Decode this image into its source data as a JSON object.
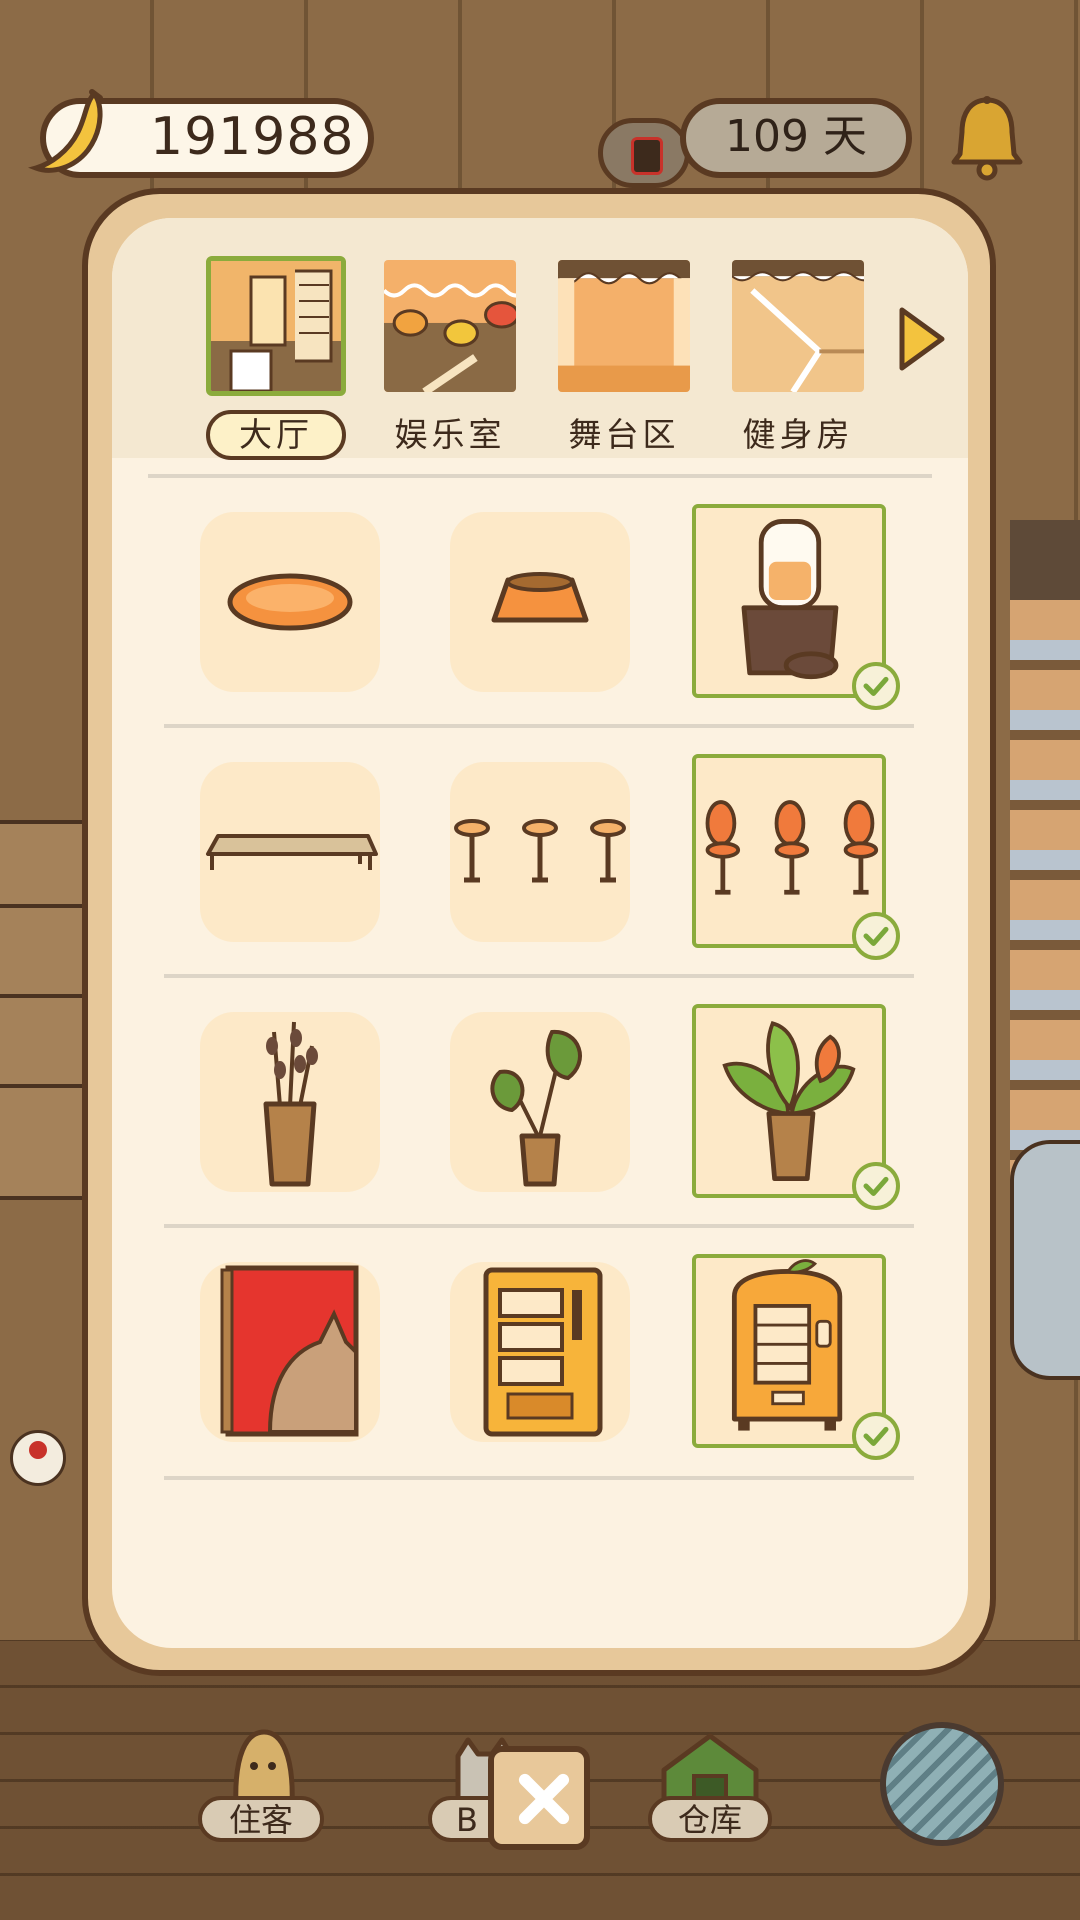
{
  "hud": {
    "coins": "191988",
    "days": "109 天"
  },
  "tabs": [
    {
      "label": "大厅",
      "active": true
    },
    {
      "label": "娱乐室",
      "active": false
    },
    {
      "label": "舞台区",
      "active": false
    },
    {
      "label": "健身房",
      "active": false
    }
  ],
  "items": [
    {
      "icon": "cat-bed-icon",
      "selected": false
    },
    {
      "icon": "food-bowl-icon",
      "selected": false
    },
    {
      "icon": "food-dispenser-icon",
      "selected": true
    },
    {
      "icon": "wooden-bench-icon",
      "selected": false
    },
    {
      "icon": "bar-stools-icon",
      "selected": false
    },
    {
      "icon": "red-bar-stools-icon",
      "selected": true
    },
    {
      "icon": "pussy-willow-plant-icon",
      "selected": false
    },
    {
      "icon": "monstera-plant-icon",
      "selected": false
    },
    {
      "icon": "leafy-potted-plant-icon",
      "selected": true
    },
    {
      "icon": "buy-buy-poster-icon",
      "selected": false
    },
    {
      "icon": "push-vending-machine-icon",
      "selected": false
    },
    {
      "icon": "orange-vending-machine-icon",
      "selected": true
    }
  ],
  "bottom_nav": {
    "guests_label": "住客",
    "b_label": "B",
    "warehouse_label": "仓库"
  },
  "colors": {
    "accent_green": "#8bab3c",
    "panel_cream": "#fcf2e1",
    "outline_brown": "#5a3a22",
    "item_bg": "#fde9c8"
  }
}
